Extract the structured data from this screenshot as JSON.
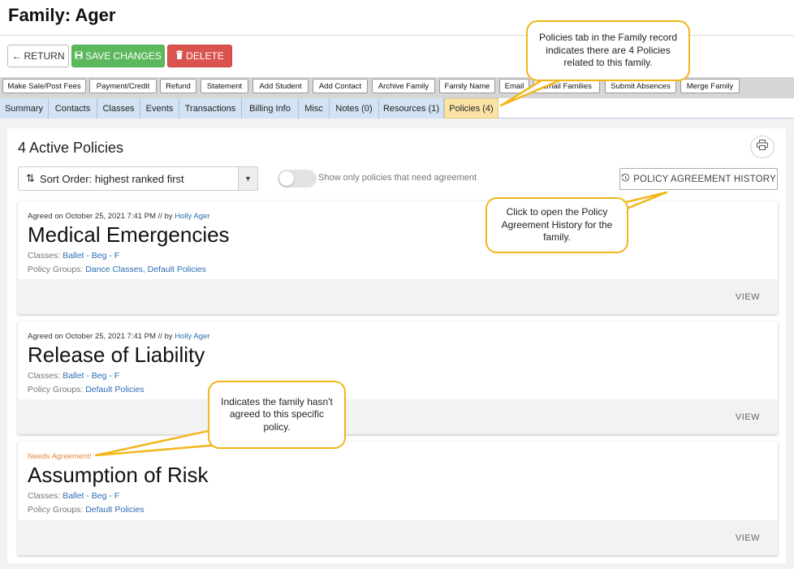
{
  "page": {
    "title": "Family: Ager"
  },
  "toolbar": {
    "return_label": "RETURN",
    "save_label": "SAVE CHANGES",
    "delete_label": "DELETE"
  },
  "actions": [
    "Make Sale/Post Fees",
    "Payment/Credit",
    "Refund",
    "Statement",
    "Add Student",
    "Add Contact",
    "Archive Family",
    "Family Name",
    "Email",
    "Email Families",
    "Submit Absences",
    "Merge Family"
  ],
  "tabs": [
    "Summary",
    "Contacts",
    "Classes",
    "Events",
    "Transactions",
    "Billing Info",
    "Misc",
    "Notes (0)",
    "Resources (1)",
    "Policies (4)"
  ],
  "active_tab": "Policies (4)",
  "policies_view": {
    "heading": "4 Active Policies",
    "sort_label": "Sort Order: highest ranked first",
    "toggle_label": "Show only policies that need agreement",
    "history_button": "POLICY AGREEMENT HISTORY"
  },
  "cards": [
    {
      "status": "agreed",
      "agreed_prefix": "Agreed on October 25, 2021 7:41 PM // by ",
      "agreed_by": "Holly Ager",
      "title": "Medical Emergencies",
      "classes_label": "Classes: ",
      "classes_value": "Ballet - Beg - F",
      "groups_label": "Policy Groups: ",
      "groups_value": "Dance Classes, Default Policies",
      "view_label": "VIEW"
    },
    {
      "status": "agreed",
      "agreed_prefix": "Agreed on October 25, 2021 7:41 PM // by ",
      "agreed_by": "Holly Ager",
      "title": "Release of Liability",
      "classes_label": "Classes: ",
      "classes_value": "Ballet - Beg - F",
      "groups_label": "Policy Groups: ",
      "groups_value": "Default Policies",
      "view_label": "VIEW"
    },
    {
      "status": "needs",
      "needs_label": "Needs Agreement!",
      "title": "Assumption of Risk",
      "classes_label": "Classes: ",
      "classes_value": "Ballet - Beg - F",
      "groups_label": "Policy Groups: ",
      "groups_value": "Default Policies",
      "view_label": "VIEW"
    }
  ],
  "callouts": {
    "policies_tab": "Policies tab in the Family record indicates there are 4 Policies related to this family.",
    "history": "Click to open the Policy Agreement History for the family.",
    "needs": "Indicates the family hasn't agreed to this specific policy."
  },
  "colors": {
    "save": "#5cb85c",
    "delete": "#d9534f",
    "tab": "#d3e3f3",
    "active_tab": "#fbe3a6",
    "callout_border": "#f2b61b",
    "link": "#2a6db0",
    "needs": "#e08a3c"
  }
}
